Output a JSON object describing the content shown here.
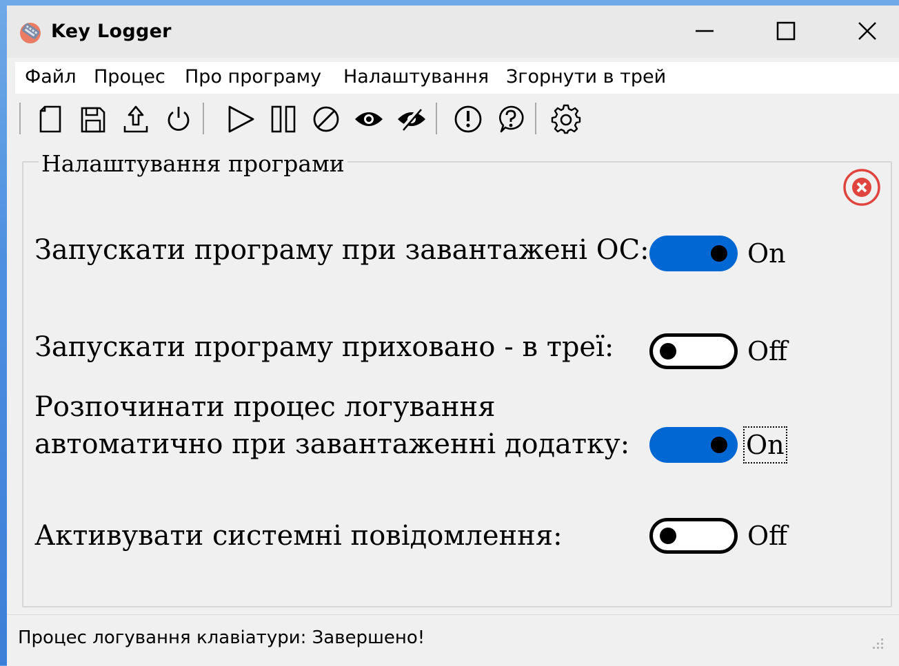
{
  "window": {
    "title": "Key Logger"
  },
  "menu": [
    {
      "label": "Файл"
    },
    {
      "label": "Процес"
    },
    {
      "label": "Про програму"
    },
    {
      "label": "Налаштування"
    },
    {
      "label": "Згорнути в трей"
    }
  ],
  "toolbar": {
    "icons": [
      "new-file-icon",
      "save-icon",
      "upload-icon",
      "power-icon",
      "play-icon",
      "pause-icon",
      "stop-icon",
      "show-icon",
      "hide-icon",
      "warning-icon",
      "help-icon",
      "settings-gear-icon"
    ]
  },
  "settings": {
    "group_title": "Налаштування програми",
    "items": [
      {
        "label": "Запускати програму при завантажені ОС:",
        "state": "On",
        "on": true
      },
      {
        "label": "Запускати програму приховано - в треї:",
        "state": "Off",
        "on": false
      },
      {
        "label_line1": "Розпочинати процес логування",
        "label_line2": "автоматично при завантаженні додатку:",
        "state": "On",
        "on": true
      },
      {
        "label": "Активувати системні повідомлення:",
        "state": "Off",
        "on": false
      }
    ]
  },
  "status": {
    "text": "Процес логування клавіатури: Завершено!"
  },
  "colors": {
    "toggle_on": "#0067d3",
    "close_circle": "#e0443e",
    "background": "#f0f0f0"
  }
}
